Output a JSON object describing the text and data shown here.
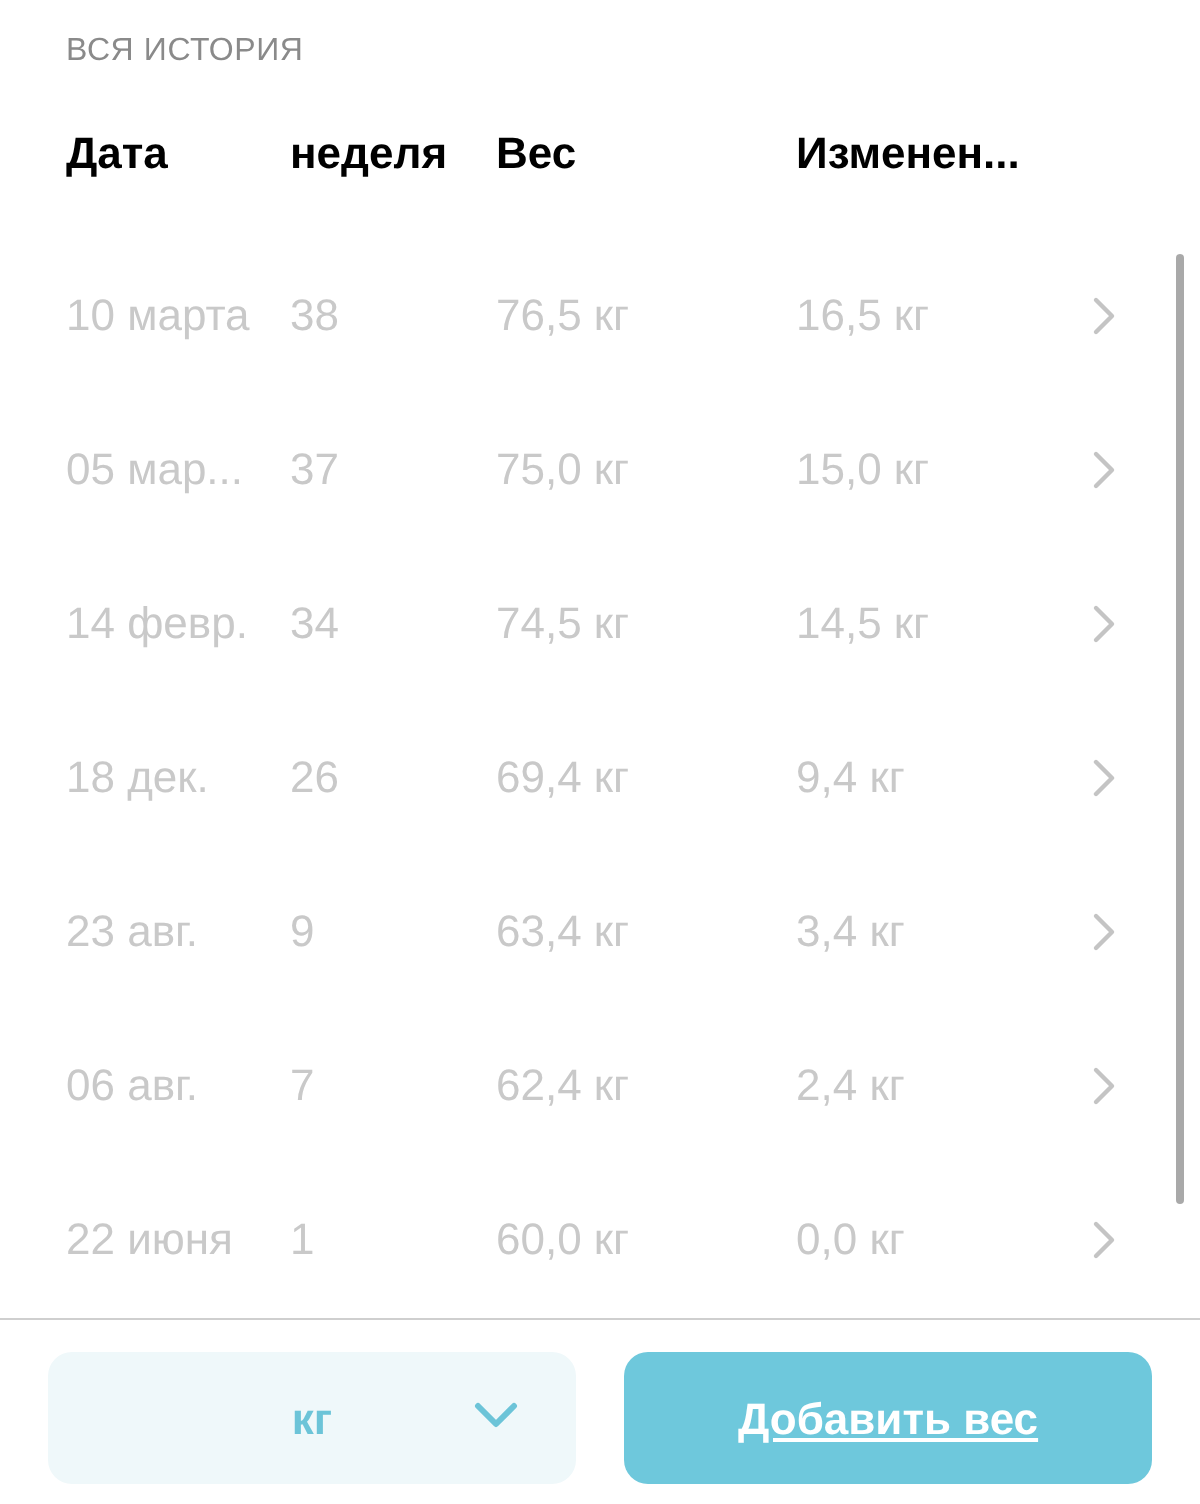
{
  "section_title": "ВСЯ ИСТОРИЯ",
  "table": {
    "columns": [
      "Дата",
      "неделя",
      "Вес",
      "Изменен..."
    ],
    "rows": [
      {
        "date": "10 марта",
        "week": "38",
        "weight": "76,5 кг",
        "change": "16,5 кг"
      },
      {
        "date": "05 мар...",
        "week": "37",
        "weight": "75,0 кг",
        "change": "15,0 кг"
      },
      {
        "date": "14 февр.",
        "week": "34",
        "weight": "74,5 кг",
        "change": "14,5 кг"
      },
      {
        "date": "18 дек.",
        "week": "26",
        "weight": "69,4 кг",
        "change": "9,4 кг"
      },
      {
        "date": "23 авг.",
        "week": "9",
        "weight": "63,4 кг",
        "change": "3,4 кг"
      },
      {
        "date": "06 авг.",
        "week": "7",
        "weight": "62,4 кг",
        "change": "2,4 кг"
      },
      {
        "date": "22 июня",
        "week": "1",
        "weight": "60,0 кг",
        "change": "0,0 кг"
      }
    ]
  },
  "unit_select": {
    "value": "кг"
  },
  "add_button": {
    "label": "Добавить вес"
  }
}
